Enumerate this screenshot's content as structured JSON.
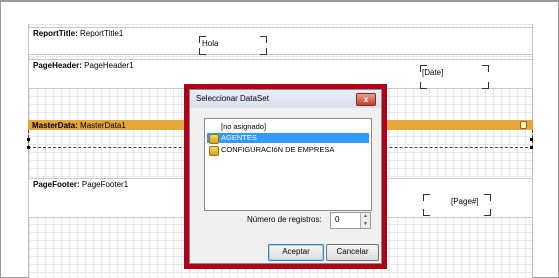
{
  "bands": {
    "report_title": {
      "kind": "ReportTitle:",
      "name": "ReportTitle1",
      "memo": "Hola"
    },
    "page_header": {
      "kind": "PageHeader:",
      "name": "PageHeader1",
      "memo": "[Date]"
    },
    "master_data": {
      "kind": "MasterData:",
      "name": "MasterData1",
      "color": "#e7a63a"
    },
    "page_footer": {
      "kind": "PageFooter:",
      "name": "PageFooter1",
      "memo": "[Page#]"
    }
  },
  "dialog": {
    "title": "Seleccionar DataSet",
    "close_glyph": "x",
    "list_items": [
      {
        "label": "[no asignado]",
        "icon": ""
      },
      {
        "label": "AGENTES",
        "icon": "database-icon",
        "selected": true
      },
      {
        "label": "CONFIGURACIóN DE EMPRESA",
        "icon": "database-icon"
      }
    ],
    "records_label": "Número de registros:",
    "records_value": "0",
    "accept_label": "Aceptar",
    "cancel_label": "Cancelar",
    "highlight_color": "#b00018"
  }
}
